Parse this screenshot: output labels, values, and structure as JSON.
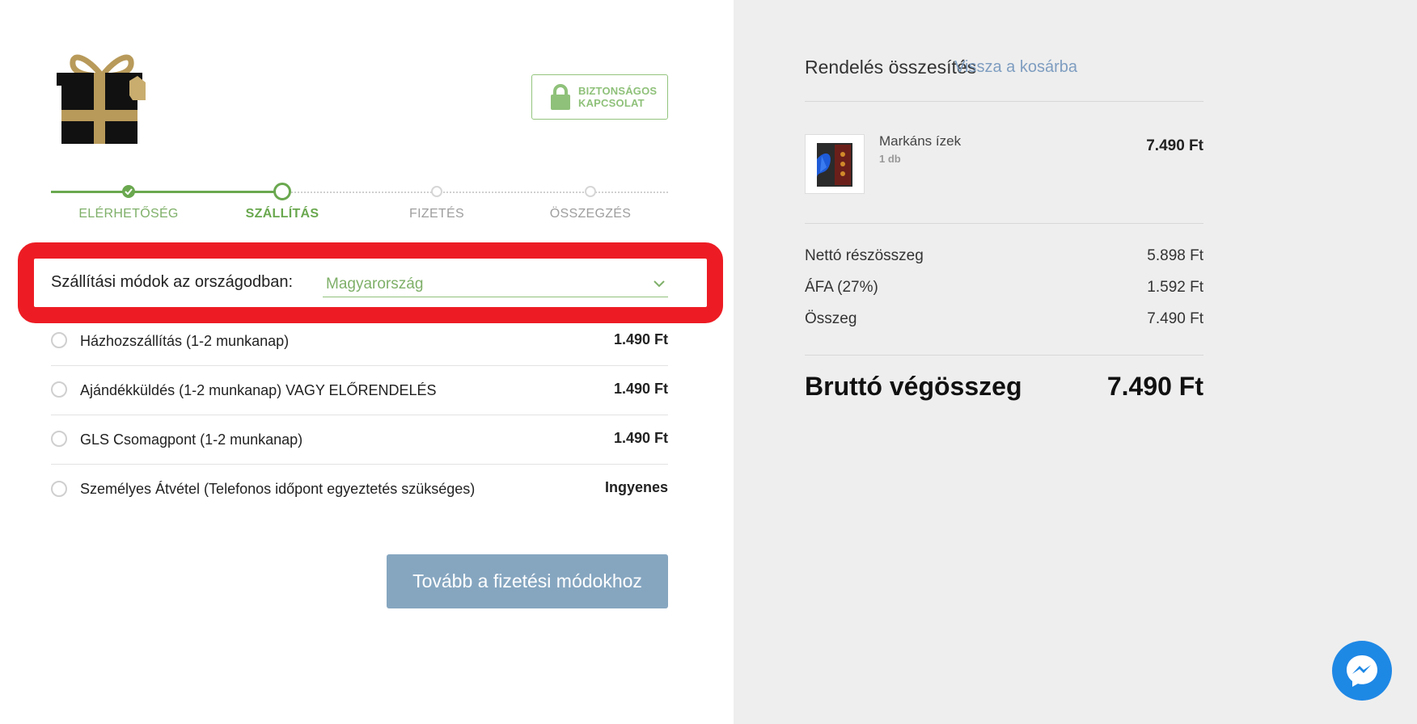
{
  "secure_badge": {
    "line1": "BIZTONSÁGOS",
    "line2": "KAPCSOLAT"
  },
  "steps": [
    {
      "label": "ELÉRHETŐSÉG",
      "state": "done"
    },
    {
      "label": "SZÁLLÍTÁS",
      "state": "current"
    },
    {
      "label": "FIZETÉS",
      "state": "todo"
    },
    {
      "label": "ÖSSZEGZÉS",
      "state": "todo"
    }
  ],
  "shipping": {
    "country_label": "Szállítási módok az országodban:",
    "country_value": "Magyarország",
    "options": [
      {
        "name": "Házhozszállítás (1-2 munkanap)",
        "price": "1.490 Ft"
      },
      {
        "name": "Ajándékküldés (1-2 munkanap) VAGY ELŐRENDELÉS",
        "price": "1.490 Ft"
      },
      {
        "name": "GLS Csomagpont (1-2 munkanap)",
        "price": "1.490 Ft"
      },
      {
        "name": "Személyes Átvétel (Telefonos időpont egyeztetés szükséges)",
        "price": "Ingyenes"
      }
    ],
    "continue_label": "Tovább a fizetési módokhoz"
  },
  "summary": {
    "title": "Rendelés összesítés",
    "back_link": "Vissza a kosárba",
    "item": {
      "name": "Markáns ízek",
      "qty": "1 db",
      "price": "7.490 Ft"
    },
    "rows": [
      {
        "label": "Nettó részösszeg",
        "value": "5.898 Ft"
      },
      {
        "label": "ÁFA (27%)",
        "value": "1.592 Ft"
      },
      {
        "label": "Összeg",
        "value": "7.490 Ft"
      }
    ],
    "total_label": "Bruttó végösszeg",
    "total_value": "7.490 Ft"
  },
  "colors": {
    "accent": "#6aa84f",
    "highlight": "#ed1c24",
    "button": "#86a6c0",
    "link": "#7e9dc0",
    "messenger": "#1e88e5"
  },
  "icons": {
    "logo": "gift-box-icon",
    "secure": "lock-icon",
    "country": "chevron-down-icon",
    "chat": "messenger-icon"
  }
}
